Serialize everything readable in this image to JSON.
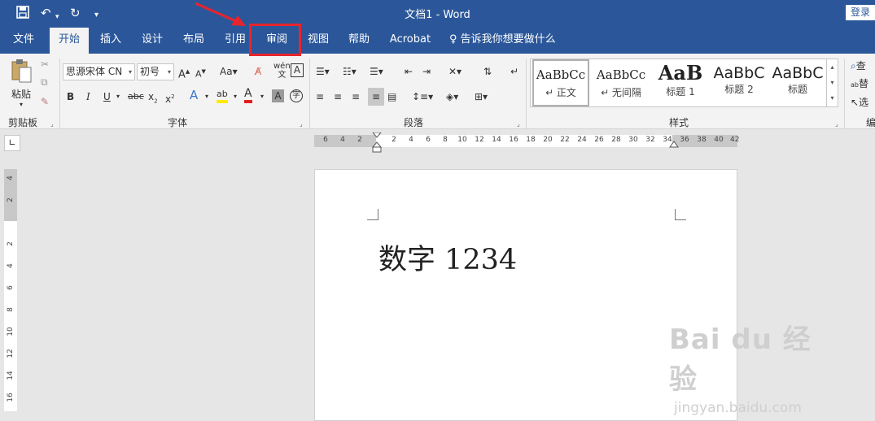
{
  "window": {
    "doc_title": "文档1  -  Word",
    "login": "登录"
  },
  "quick_access": {
    "save_icon": "save-icon",
    "undo_icon": "undo-icon",
    "redo_icon": "redo-icon",
    "customize_icon": "customize-icon"
  },
  "tabs": [
    {
      "label": "文件"
    },
    {
      "label": "开始"
    },
    {
      "label": "插入"
    },
    {
      "label": "设计"
    },
    {
      "label": "布局"
    },
    {
      "label": "引用"
    },
    {
      "label": "审阅"
    },
    {
      "label": "视图"
    },
    {
      "label": "帮助"
    },
    {
      "label": "Acrobat"
    }
  ],
  "tell_me": "告诉我你想要做什么",
  "clipboard": {
    "paste": "粘贴",
    "group": "剪贴板"
  },
  "font": {
    "name": "思源宋体 CN",
    "size": "初号",
    "group": "字体"
  },
  "paragraph": {
    "group": "段落"
  },
  "styles": {
    "group": "样式",
    "items": [
      {
        "sample": "AaBbCc",
        "name": "↵ 正文"
      },
      {
        "sample": "AaBbCc",
        "name": "↵ 无间隔"
      },
      {
        "sample": "AaB",
        "name": "标题 1"
      },
      {
        "sample": "AaBbC",
        "name": "标题 2"
      },
      {
        "sample": "AaBbC",
        "name": "标题"
      }
    ]
  },
  "editing": {
    "find": "查",
    "replace": "替",
    "select": "选",
    "group": "编"
  },
  "ruler": {
    "h_ticks": [
      "6",
      "4",
      "2",
      "2",
      "4",
      "6",
      "8",
      "10",
      "12",
      "14",
      "16",
      "18",
      "20",
      "22",
      "24",
      "26",
      "28",
      "30",
      "32",
      "34",
      "36",
      "38",
      "40",
      "42"
    ],
    "v_ticks": [
      "4",
      "2",
      "2",
      "4",
      "6",
      "8",
      "10",
      "12",
      "14",
      "16"
    ]
  },
  "document": {
    "text": "数字 1234"
  },
  "watermark": {
    "brand": "Bai du 经验",
    "url": "jingyan.baidu.com"
  }
}
